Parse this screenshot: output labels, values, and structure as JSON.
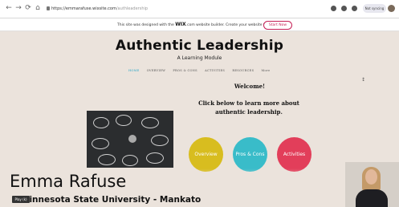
{
  "browser": {
    "url_host": "https://emmarafuse.wixsite.com",
    "url_path": "/authleadership",
    "profile_label": "Not syncing",
    "nav": [
      "←",
      "→",
      "⟳",
      "⌂"
    ]
  },
  "wix_banner": {
    "text_prefix": "This site was designed with the",
    "brand": "WIX",
    "text_suffix": ".com website builder. Create your website today.",
    "cta": "Start Now"
  },
  "site": {
    "title": "Authentic Leadership",
    "subtitle": "A Learning Module",
    "nav": [
      {
        "label": "HOME",
        "active": true
      },
      {
        "label": "OVERVIEW",
        "active": false
      },
      {
        "label": "PROS & CONS",
        "active": false
      },
      {
        "label": "ACTIVITIES",
        "active": false
      },
      {
        "label": "RESOURCES",
        "active": false
      },
      {
        "label": "More",
        "active": false
      }
    ],
    "welcome": "Welcome!",
    "intro": "Click below to learn more about authentic leadership.",
    "buttons": [
      {
        "label": "Overview",
        "color": "#d8bd1f"
      },
      {
        "label": "Pros & Cons",
        "color": "#39bcc9"
      },
      {
        "label": "Activities",
        "color": "#e23e5a"
      }
    ]
  },
  "overlay": {
    "presenter_name": "Emma Rafuse",
    "institution": "Minnesota State University - Mankato",
    "badge": "Play (k)"
  },
  "colors": {
    "nav_active": "#2aa6c8",
    "wix_accent": "#c51f55"
  }
}
